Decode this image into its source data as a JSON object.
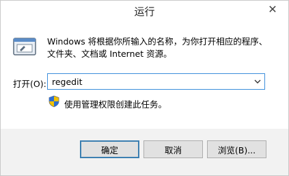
{
  "window": {
    "title": "运行",
    "close_glyph": "✕"
  },
  "dialog": {
    "description": "Windows 将根据你所输入的名称，为你打开相应的程序、文件夹、文档或 Internet 资源。",
    "open_label": "打开(O):",
    "open_value": "regedit",
    "admin_note": "使用管理权限创建此任务。"
  },
  "buttons": {
    "ok_label": "确定",
    "cancel_label": "取消",
    "browse_label": "浏览(B)..."
  },
  "icons": {
    "app": "run-icon",
    "shield": "uac-shield-icon",
    "dropdown": "chevron-down-icon"
  }
}
